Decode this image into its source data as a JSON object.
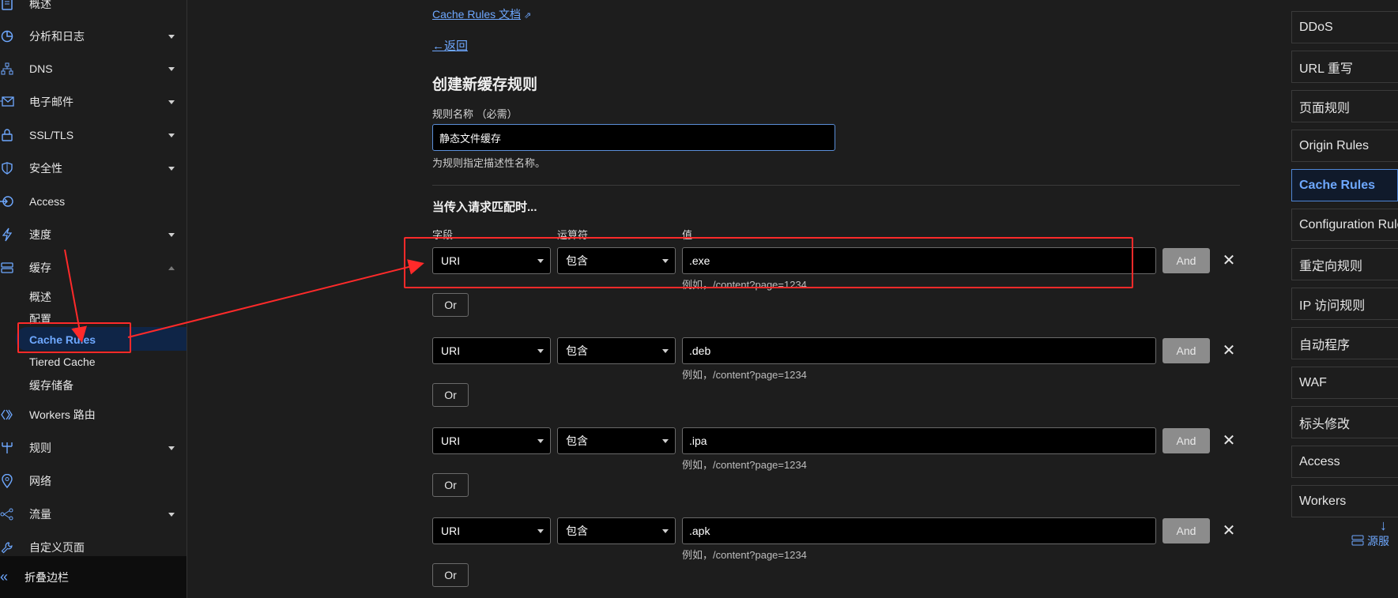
{
  "sidebar": {
    "items": [
      {
        "label": "概述",
        "icon": "document-icon",
        "caret": "none"
      },
      {
        "label": "分析和日志",
        "icon": "chart-icon",
        "caret": "down"
      },
      {
        "label": "DNS",
        "icon": "sitemap-icon",
        "caret": "down"
      },
      {
        "label": "电子邮件",
        "icon": "email-icon",
        "caret": "down"
      },
      {
        "label": "SSL/TLS",
        "icon": "lock-icon",
        "caret": "down"
      },
      {
        "label": "安全性",
        "icon": "shield-icon",
        "caret": "down"
      },
      {
        "label": "Access",
        "icon": "access-icon",
        "caret": "none"
      },
      {
        "label": "速度",
        "icon": "lightning-icon",
        "caret": "down"
      },
      {
        "label": "缓存",
        "icon": "cache-icon",
        "caret": "up"
      }
    ],
    "cache_sub_items": [
      "概述",
      "配置",
      "Cache Rules",
      "Tiered Cache",
      "缓存储备"
    ],
    "more_items": [
      {
        "label": "Workers 路由",
        "icon": "workers-icon",
        "caret": "none"
      },
      {
        "label": "规则",
        "icon": "rules-icon",
        "caret": "down"
      },
      {
        "label": "网络",
        "icon": "location-icon",
        "caret": "none"
      },
      {
        "label": "流量",
        "icon": "traffic-icon",
        "caret": "down"
      },
      {
        "label": "自定义页面",
        "icon": "wrench-icon",
        "caret": "none"
      }
    ],
    "collapse_label": "折叠边栏"
  },
  "main": {
    "docs_link": "Cache Rules 文档",
    "back_link": "←返回",
    "title": "创建新缓存规则",
    "rule_name_label": "规则名称 （必需）",
    "rule_name_value": "静态文件缓存",
    "rule_name_help": "为规则指定描述性名称。",
    "match_heading": "当传入请求匹配时...",
    "col_field": "字段",
    "col_operator": "运算符",
    "col_value": "值",
    "and_label": "And",
    "or_label": "Or",
    "conditions": [
      {
        "field": "URI",
        "operator": "包含",
        "value": ".exe",
        "example": "例如，/content?page=1234"
      },
      {
        "field": "URI",
        "operator": "包含",
        "value": ".deb",
        "example": "例如，/content?page=1234"
      },
      {
        "field": "URI",
        "operator": "包含",
        "value": ".ipa",
        "example": "例如，/content?page=1234"
      },
      {
        "field": "URI",
        "operator": "包含",
        "value": ".apk",
        "example": "例如，/content?page=1234"
      }
    ]
  },
  "right_nav": {
    "items": [
      "DDoS",
      "URL 重写",
      "页面规则",
      "Origin Rules",
      "Cache Rules",
      "Configuration Rules",
      "重定向规则",
      "IP 访问规则",
      "自动程序",
      "WAF",
      "标头修改",
      "Access",
      "Workers"
    ],
    "active": "Cache Rules",
    "footer_label": "源服"
  },
  "colors": {
    "accent": "#6ea8ff",
    "annotation": "#ff2a2a",
    "background": "#1d1d1d"
  }
}
